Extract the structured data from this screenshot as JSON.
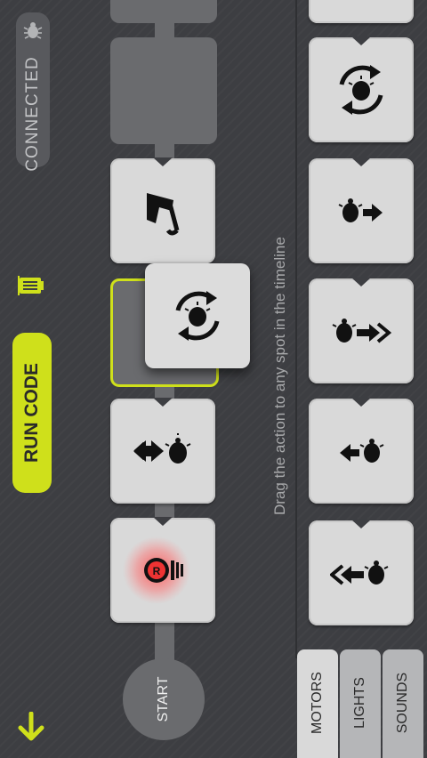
{
  "status": {
    "connection_label": "CONNECTED"
  },
  "controls": {
    "run_label": "RUN CODE"
  },
  "timeline": {
    "start_label": "START",
    "hint": "Drag the action to any spot in the timeline",
    "blocks": [
      {
        "name": "lights-red-block",
        "icon": "red-light-icon"
      },
      {
        "name": "move-backward-block",
        "icon": "move-backward-icon"
      },
      {
        "name": "sound-block",
        "icon": "music-note-icon"
      }
    ],
    "dragging_block": {
      "name": "rotate-block",
      "icon": "rotate-icon"
    }
  },
  "palette": {
    "tabs": [
      {
        "label": "MOTORS",
        "active": true
      },
      {
        "label": "LIGHTS",
        "active": false
      },
      {
        "label": "SOUNDS",
        "active": false
      }
    ],
    "blocks": [
      {
        "name": "fast-backward",
        "icon": "fast-backward-icon"
      },
      {
        "name": "slow-backward",
        "icon": "slow-backward-icon"
      },
      {
        "name": "fast-forward",
        "icon": "fast-forward-icon"
      },
      {
        "name": "slow-forward",
        "icon": "slow-forward-icon"
      },
      {
        "name": "rotate",
        "icon": "rotate-icon"
      }
    ]
  },
  "colors": {
    "accent": "#cfe01b",
    "background": "#3d3e42",
    "tile": "#d9d9d9",
    "track": "#6a6b6e"
  }
}
